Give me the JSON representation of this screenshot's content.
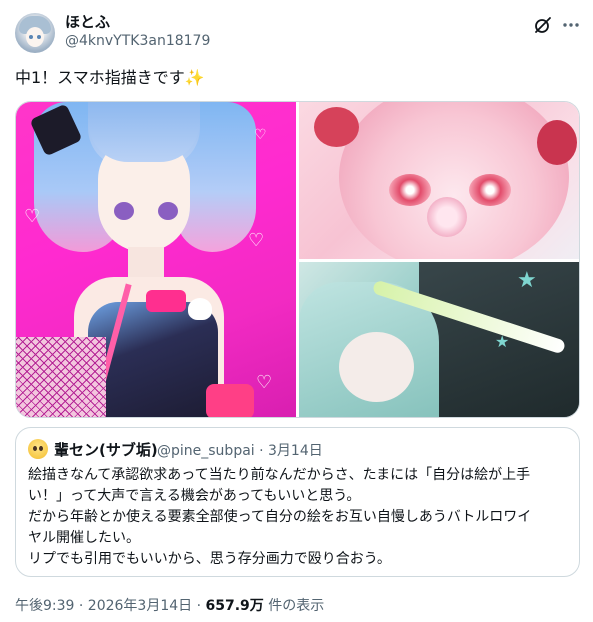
{
  "author": {
    "display_name": "ほとふ",
    "handle": "@4knvYTK3an18179"
  },
  "header_icons": [
    "grok-icon",
    "more-icon"
  ],
  "tweet": {
    "text": "中1！スマホ指描きです",
    "emoji": "✨"
  },
  "media": {
    "images": [
      "illustration-bunny-girl",
      "illustration-pink-hair-demon",
      "illustration-teal-hair-girl"
    ]
  },
  "quote": {
    "display_name": "輩セン(サブ垢)",
    "handle_and_date": "@pine_subpai · 3月14日",
    "lines": [
      "絵描きなんて承認欲求あって当たり前なんだからさ、たまには「自分は絵が上手",
      "い！」って大声で言える機会があってもいいと思う。",
      "だから年齢とか使える要素全部使って自分の絵をお互い自慢しあうバトルロワイ",
      "ヤル開催したい。",
      "リプでも引用でもいいから、思う存分画力で殴り合おう。"
    ]
  },
  "meta": {
    "time_date": "午後9:39 · 2026年3月14日 · ",
    "views_count": "657.9万",
    "views_label": " 件の表示"
  },
  "colors": {
    "text": "#0f1419",
    "secondary": "#536471",
    "border": "#cfd9de",
    "accent_magenta": "#ff2ad0"
  }
}
